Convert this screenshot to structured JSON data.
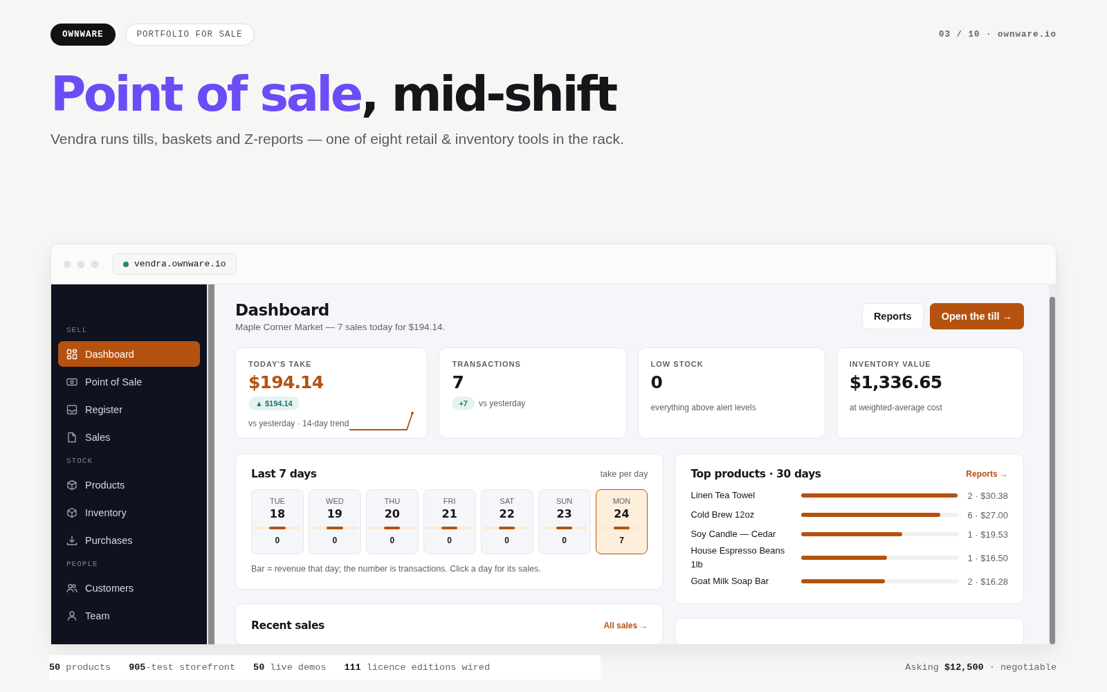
{
  "top_bar": {
    "brand": "OWNWARE",
    "tag": "PORTFOLIO FOR SALE",
    "page_counter": "03 / 10 · ownware.io"
  },
  "headline": {
    "accent": "Point of sale",
    "rest": ", mid-shift"
  },
  "subtitle": "Vendra runs tills, baskets and Z-reports — one of eight retail & inventory tools in the rack.",
  "browser": {
    "url": "vendra.ownware.io"
  },
  "sidebar": {
    "sections": [
      {
        "label": "SELL",
        "items": [
          {
            "label": "Dashboard",
            "selected": true
          },
          {
            "label": "Point of Sale",
            "selected": false
          },
          {
            "label": "Register",
            "selected": false
          },
          {
            "label": "Sales",
            "selected": false
          }
        ]
      },
      {
        "label": "STOCK",
        "items": [
          {
            "label": "Products",
            "selected": false
          },
          {
            "label": "Inventory",
            "selected": false
          },
          {
            "label": "Purchases",
            "selected": false
          }
        ]
      },
      {
        "label": "PEOPLE",
        "items": [
          {
            "label": "Customers",
            "selected": false
          },
          {
            "label": "Team",
            "selected": false
          }
        ]
      }
    ]
  },
  "page": {
    "title": "Dashboard",
    "subtitle": "Maple Corner Market — 7 sales today for $194.14.",
    "buttons": [
      {
        "label": "Reports",
        "kind": "secondary"
      },
      {
        "label": "Open the till →",
        "kind": "primary"
      }
    ]
  },
  "kpis": [
    {
      "label": "TODAY'S TAKE",
      "value": "$194.14",
      "accent": true,
      "badge": "▲ $194.14",
      "note": "vs yesterday · 14-day trend",
      "sparkline": true
    },
    {
      "label": "TRANSACTIONS",
      "value": "7",
      "accent": false,
      "badge": "+7",
      "note": "vs yesterday",
      "sparkline": false
    },
    {
      "label": "LOW STOCK",
      "value": "0",
      "accent": false,
      "note": "everything above alert levels",
      "sparkline": false
    },
    {
      "label": "INVENTORY VALUE",
      "value": "$1,336.65",
      "accent": false,
      "note": "at weighted-average cost",
      "sparkline": false
    }
  ],
  "last_7_days": {
    "title": "Last 7 days",
    "aside": "take per day",
    "days": [
      {
        "day": "TUE",
        "date": "18",
        "count": "0",
        "selected": false
      },
      {
        "day": "WED",
        "date": "19",
        "count": "0",
        "selected": false
      },
      {
        "day": "THU",
        "date": "20",
        "count": "0",
        "selected": false
      },
      {
        "day": "FRI",
        "date": "21",
        "count": "0",
        "selected": false
      },
      {
        "day": "SAT",
        "date": "22",
        "count": "0",
        "selected": false
      },
      {
        "day": "SUN",
        "date": "23",
        "count": "0",
        "selected": false
      },
      {
        "day": "MON",
        "date": "24",
        "count": "7",
        "selected": true
      }
    ],
    "note": "Bar = revenue that day; the number is transactions. Click a day for its sales."
  },
  "top_products": {
    "title": "Top products · 30 days",
    "link": "Reports →",
    "rows": [
      {
        "name": "Linen Tea Towel",
        "level": 0.99,
        "figure": "2 · $30.38"
      },
      {
        "name": "Cold Brew 12oz",
        "level": 0.88,
        "figure": "6 · $27.00"
      },
      {
        "name": "Soy Candle — Cedar",
        "level": 0.64,
        "figure": "1 · $19.53"
      },
      {
        "name": "House Espresso Beans 1lb",
        "level": 0.54,
        "figure": "1 · $16.50"
      },
      {
        "name": "Goat Milk Soap Bar",
        "level": 0.53,
        "figure": "2 · $16.28"
      }
    ]
  },
  "recent_sales": {
    "title": "Recent sales",
    "link": "All sales →"
  },
  "footer": {
    "stats": [
      {
        "value": "50",
        "label": "products"
      },
      {
        "value": "905",
        "label": "-test storefront"
      },
      {
        "value": "50",
        "label": "live demos"
      },
      {
        "value": "111",
        "label": "licence editions wired"
      }
    ],
    "asking": "Asking **$12,500** · negotiable"
  }
}
